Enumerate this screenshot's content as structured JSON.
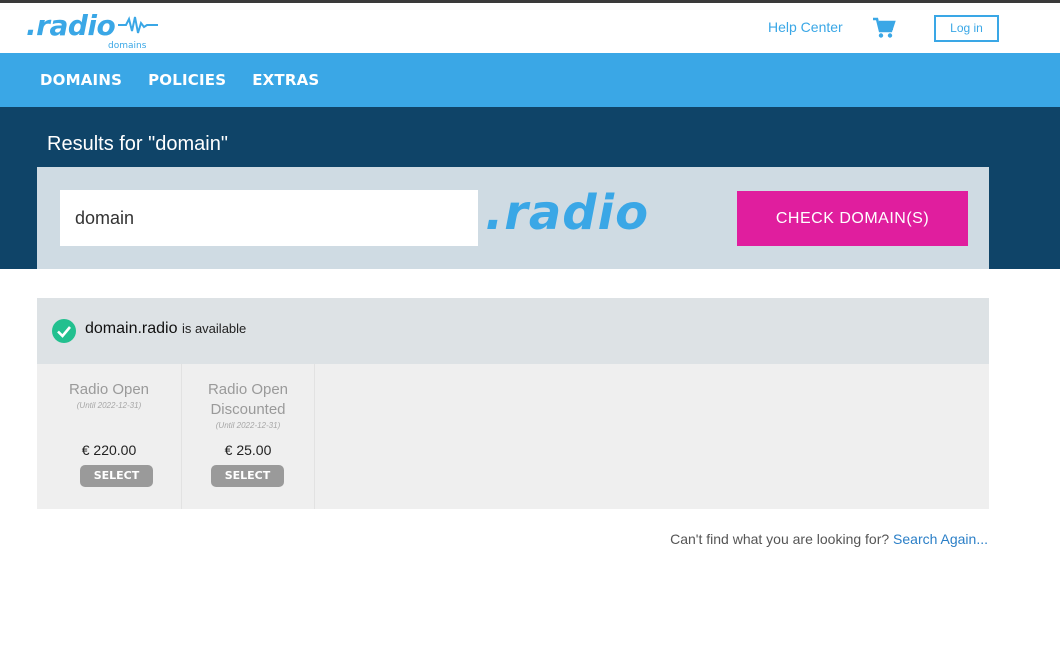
{
  "brand": {
    "name": ".radio",
    "sub": "domains",
    "color": "#3aa7e6"
  },
  "header": {
    "help_center": "Help Center",
    "cart_icon": "cart-icon",
    "login": "Log in"
  },
  "nav": {
    "items": [
      "DOMAINS",
      "POLICIES",
      "EXTRAS"
    ]
  },
  "hero": {
    "title": "Results for \"domain\"",
    "search_value": "domain",
    "tld": ".radio",
    "check_button": "CHECK DOMAIN(S)",
    "check_button_color": "#e01e9e"
  },
  "result": {
    "domain": "domain.radio",
    "status": "is available",
    "status_icon": "check-circle-icon",
    "plans": [
      {
        "name": "Radio Open",
        "until": "(Until 2022-12-31)",
        "price": "€ 220.00",
        "select": "SELECT"
      },
      {
        "name": "Radio Open Discounted",
        "until": "(Until 2022-12-31)",
        "price": "€ 25.00",
        "select": "SELECT"
      }
    ]
  },
  "footer": {
    "question": "Can't find what you are looking for?",
    "search_again": "Search Again..."
  }
}
